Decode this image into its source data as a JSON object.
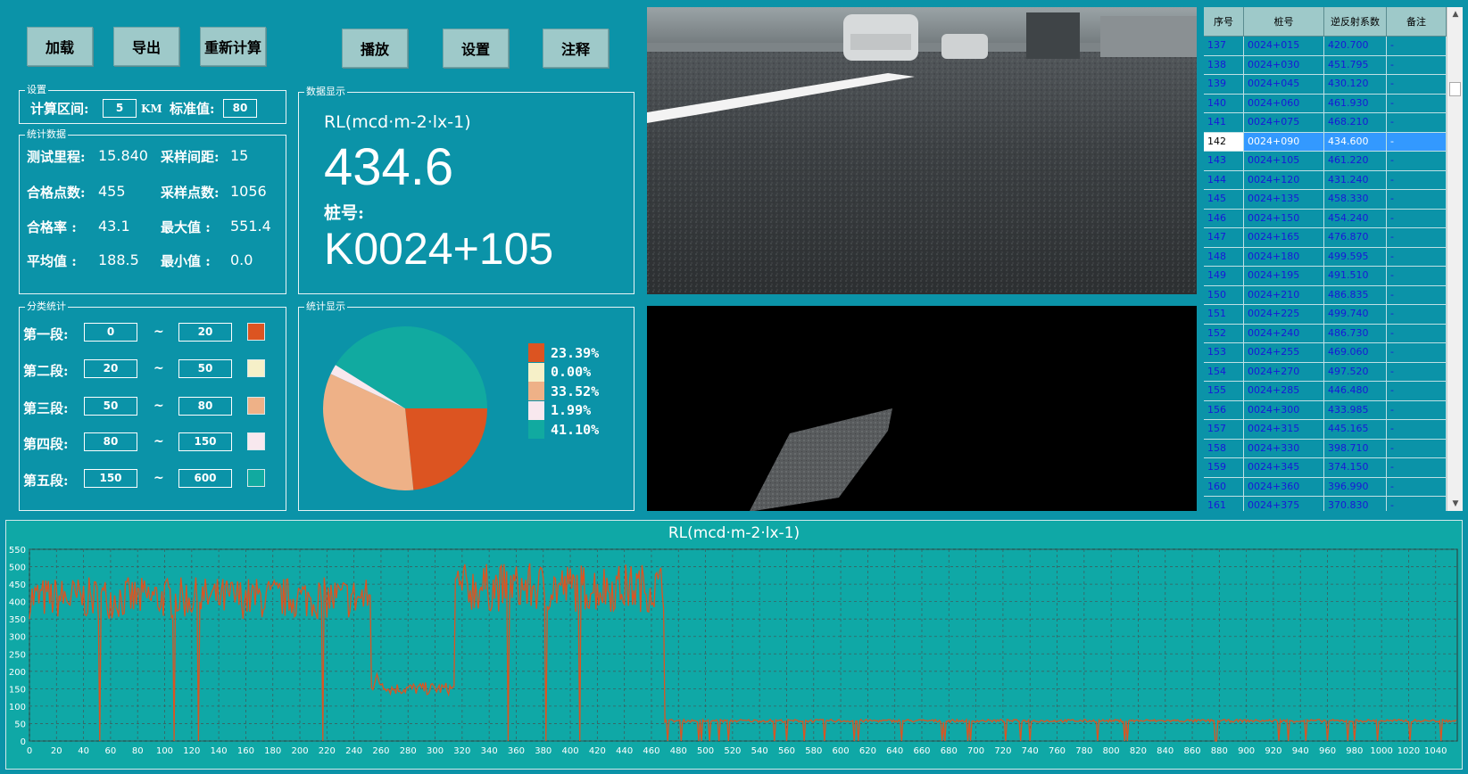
{
  "toolbar": {
    "load": "加载",
    "export": "导出",
    "recalc": "重新计算",
    "play": "播放",
    "settings": "设置",
    "annotate": "注释"
  },
  "settings_group": {
    "title": "设置",
    "interval_label": "计算区间:",
    "interval_value": "5",
    "interval_unit": "KM",
    "standard_label": "标准值:",
    "standard_value": "80"
  },
  "stats_group": {
    "title": "统计数据",
    "rows": [
      [
        "测试里程:",
        "15.840",
        "采样间距:",
        "15"
      ],
      [
        "合格点数:",
        "455",
        "采样点数:",
        "1056"
      ],
      [
        "合格率  :",
        "43.1",
        "最大值  :",
        "551.4"
      ],
      [
        "平均值  :",
        "188.5",
        "最小值  :",
        "0.0"
      ]
    ]
  },
  "display_group": {
    "title": "数据显示",
    "unit": "RL(mcd·m-2·lx-1)",
    "value": "434.6",
    "station_label": "桩号:",
    "station": "K0024+105"
  },
  "class_group": {
    "title": "分类统计",
    "segments": [
      {
        "label": "第一段:",
        "from": "0",
        "to": "20",
        "color": "#dc5421"
      },
      {
        "label": "第二段:",
        "from": "20",
        "to": "50",
        "color": "#f6f0c8"
      },
      {
        "label": "第三段:",
        "from": "50",
        "to": "80",
        "color": "#eeb187"
      },
      {
        "label": "第四段:",
        "from": "80",
        "to": "150",
        "color": "#f8e8ee"
      },
      {
        "label": "第五段:",
        "from": "150",
        "to": "600",
        "color": "#11aaa0"
      }
    ],
    "tilde": "~"
  },
  "pie_group": {
    "title": "统计显示"
  },
  "table": {
    "headers": [
      "序号",
      "桩号",
      "逆反射系数",
      "备注"
    ],
    "selected_index": 5,
    "rows": [
      [
        "137",
        "0024+015",
        "420.700",
        "-"
      ],
      [
        "138",
        "0024+030",
        "451.795",
        "-"
      ],
      [
        "139",
        "0024+045",
        "430.120",
        "-"
      ],
      [
        "140",
        "0024+060",
        "461.930",
        "-"
      ],
      [
        "141",
        "0024+075",
        "468.210",
        "-"
      ],
      [
        "142",
        "0024+090",
        "434.600",
        "-"
      ],
      [
        "143",
        "0024+105",
        "461.220",
        "-"
      ],
      [
        "144",
        "0024+120",
        "431.240",
        "-"
      ],
      [
        "145",
        "0024+135",
        "458.330",
        "-"
      ],
      [
        "146",
        "0024+150",
        "454.240",
        "-"
      ],
      [
        "147",
        "0024+165",
        "476.870",
        "-"
      ],
      [
        "148",
        "0024+180",
        "499.595",
        "-"
      ],
      [
        "149",
        "0024+195",
        "491.510",
        "-"
      ],
      [
        "150",
        "0024+210",
        "486.835",
        "-"
      ],
      [
        "151",
        "0024+225",
        "499.740",
        "-"
      ],
      [
        "152",
        "0024+240",
        "486.730",
        "-"
      ],
      [
        "153",
        "0024+255",
        "469.060",
        "-"
      ],
      [
        "154",
        "0024+270",
        "497.520",
        "-"
      ],
      [
        "155",
        "0024+285",
        "446.480",
        "-"
      ],
      [
        "156",
        "0024+300",
        "433.985",
        "-"
      ],
      [
        "157",
        "0024+315",
        "445.165",
        "-"
      ],
      [
        "158",
        "0024+330",
        "398.710",
        "-"
      ],
      [
        "159",
        "0024+345",
        "374.150",
        "-"
      ],
      [
        "160",
        "0024+360",
        "396.990",
        "-"
      ],
      [
        "161",
        "0024+375",
        "370.830",
        "-"
      ]
    ]
  },
  "chart_data": [
    {
      "type": "pie",
      "labels": [
        "23.39%",
        "0.00%",
        "33.52%",
        "1.99%",
        "41.10%"
      ],
      "values": [
        23.39,
        0.0,
        33.52,
        1.99,
        41.1
      ],
      "colors": [
        "#dc5421",
        "#f6f0c8",
        "#eeb187",
        "#f8e8ee",
        "#11aaa0"
      ],
      "legend": "right"
    },
    {
      "type": "line",
      "title": "RL(mcd·m-2·lx-1)",
      "xlim": [
        0,
        1056
      ],
      "ylim": [
        0,
        550
      ],
      "xticks": [
        0,
        20,
        40,
        60,
        80,
        100,
        120,
        140,
        160,
        180,
        200,
        220,
        240,
        260,
        280,
        300,
        320,
        340,
        360,
        380,
        400,
        420,
        440,
        460,
        480,
        500,
        520,
        540,
        560,
        580,
        600,
        620,
        640,
        660,
        680,
        700,
        720,
        740,
        760,
        780,
        800,
        820,
        840,
        860,
        880,
        900,
        920,
        940,
        960,
        980,
        1000,
        1020,
        1040
      ],
      "yticks": [
        0,
        50,
        100,
        150,
        200,
        250,
        300,
        350,
        400,
        450,
        500,
        550
      ],
      "grid": true,
      "line_color": "#dc5421",
      "segments": [
        {
          "from": 0,
          "to": 253,
          "base": 410,
          "amp": 60
        },
        {
          "from": 253,
          "to": 265,
          "base": 170,
          "amp": 30
        },
        {
          "from": 265,
          "to": 315,
          "base": 150,
          "amp": 18
        },
        {
          "from": 315,
          "to": 470,
          "base": 440,
          "amp": 70
        },
        {
          "from": 470,
          "to": 1056,
          "base": 58,
          "amp": 4
        }
      ]
    }
  ]
}
